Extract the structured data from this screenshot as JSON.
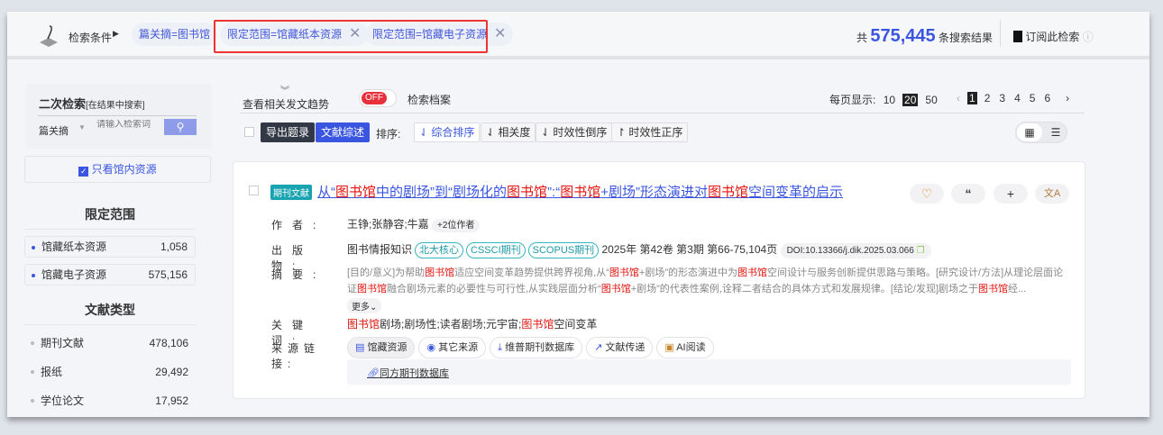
{
  "header": {
    "conditions_label": "检索条件",
    "chips": [
      {
        "label": "篇关摘=图书馆"
      },
      {
        "label": "限定范围=馆藏纸本资源"
      },
      {
        "label": "限定范围=馆藏电子资源"
      }
    ],
    "total_prefix": "共",
    "total": "575,445",
    "total_suffix": "条搜索结果",
    "subscribe": "订阅此检索"
  },
  "sidebar": {
    "title": "二次检索",
    "subtitle": "[在结果中搜索]",
    "field": "篇关摘",
    "placeholder": "请输入检索词",
    "only_library": "只看馆内资源",
    "scope_title": "限定范围",
    "scope": [
      {
        "label": "馆藏纸本资源",
        "count": "1,058"
      },
      {
        "label": "馆藏电子资源",
        "count": "575,156"
      }
    ],
    "type_title": "文献类型",
    "types": [
      {
        "label": "期刊文献",
        "count": "478,106"
      },
      {
        "label": "报纸",
        "count": "29,492"
      },
      {
        "label": "学位论文",
        "count": "17,952"
      }
    ]
  },
  "toolbar": {
    "trend": "查看相关发文趋势",
    "toggle": "OFF",
    "archive": "检索档案",
    "per_page_label": "每页显示:",
    "per_page": [
      "10",
      "20",
      "50"
    ],
    "pages": [
      "1",
      "2",
      "3",
      "4",
      "5",
      "6"
    ],
    "export": "导出题录",
    "review": "文献综述",
    "sort_label": "排序:",
    "sorts": [
      "综合排序",
      "相关度",
      "时效性倒序",
      "时效性正序"
    ]
  },
  "result": {
    "type_badge": "期刊文献",
    "title": [
      [
        "从“",
        0
      ],
      [
        "图书馆",
        1
      ],
      [
        "中的剧场”到“剧场化的",
        0
      ],
      [
        "图书馆",
        1
      ],
      [
        "”:“",
        0
      ],
      [
        "图书馆",
        1
      ],
      [
        "+剧场”形态演进对",
        0
      ],
      [
        "图书馆",
        1
      ],
      [
        "空间变革的启示",
        0
      ]
    ],
    "labels": {
      "author": "作者:",
      "pub": "出版物:",
      "abstract": "摘要:",
      "keywords": "关键词:",
      "links": "来源链接:"
    },
    "authors": "王铮;张静容;牛嘉",
    "more_authors": "+2位作者",
    "journal": "图书情报知识",
    "tags": [
      "北大核心",
      "CSSCI期刊",
      "SCOPUS期刊"
    ],
    "issue": "2025年  第42卷  第3期  第66-75,104页",
    "doi": "DOI:10.13366/j.dik.2025.03.066",
    "abstract": [
      [
        "[目的/意义]为帮助",
        0
      ],
      [
        "图书馆",
        1
      ],
      [
        "适应空间变革趋势提供跨界视角,从“",
        0
      ],
      [
        "图书馆",
        1
      ],
      [
        "+剧场”的形态演进中为",
        0
      ],
      [
        "图书馆",
        1
      ],
      [
        "空间设计与服务创新提供思路与策略。[研究设计/方法]从理论层面论证",
        0
      ],
      [
        "图书馆",
        1
      ],
      [
        "融合剧场元素的必要性与可行性,从实践层面分析“",
        0
      ],
      [
        "图书馆",
        1
      ],
      [
        "+剧场”的代表性案例,诠释二者结合的具体方式和发展规律。[结论/发现]剧场之于",
        0
      ],
      [
        "图书馆",
        1
      ],
      [
        "经...",
        0
      ]
    ],
    "more": "更多",
    "keywords": [
      [
        "图书馆",
        1
      ],
      [
        "剧场;剧场性;读者剧场;元宇宙;",
        0
      ],
      [
        "图书馆",
        1
      ],
      [
        "空间变革",
        0
      ]
    ],
    "sources": [
      "馆藏资源",
      "其它来源",
      "维普期刊数据库",
      "文献传递",
      "AI阅读"
    ],
    "db_link": "同方期刊数据库"
  },
  "colors": {
    "accent": "#3a56e0",
    "highlight": "#e4140e",
    "red_box": "#e33333"
  }
}
